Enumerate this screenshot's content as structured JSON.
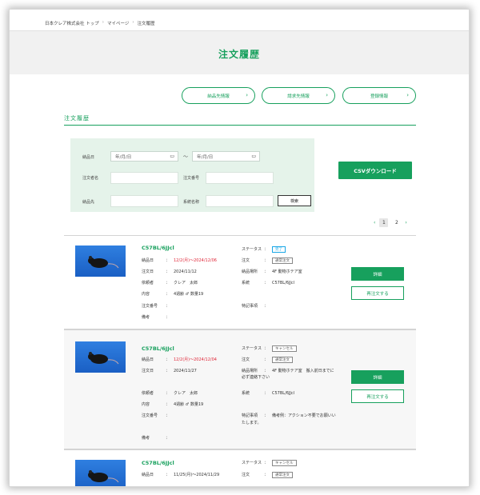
{
  "breadcrumb": [
    "日本クレア株式会社 トップ",
    "マイページ",
    "注文履歴"
  ],
  "page_title": "注文履歴",
  "nav_pills": [
    {
      "label": "納品先情報"
    },
    {
      "label": "請求先情報"
    },
    {
      "label": "登録情報"
    }
  ],
  "section_title": "注文履歴",
  "filter": {
    "delivery_date_label": "納品日",
    "date_from_placeholder": "年/月/日",
    "date_to_placeholder": "年/月/日",
    "range_sep": "〜",
    "order_name_label": "注文者名",
    "order_no_label": "注文番号",
    "destination_label": "納品先",
    "strain_label": "系統名称",
    "search_label": "検索"
  },
  "csv_label": "CSVダウンロード",
  "pagination": {
    "prev": "‹",
    "pages": [
      "1",
      "2"
    ],
    "next": "›",
    "current": "1"
  },
  "orders": [
    {
      "strain": "C57BL/6JJcl",
      "delivery_date": "12/2(月)〜2024/12/06",
      "order_date": "2024/11/12",
      "orderer": "クレア　太郎",
      "content": "4週齢 ♂ 数量19",
      "order_no": "",
      "remarks": "",
      "status_badge": "完了",
      "order_badge": "通常注文",
      "destination": "4F 動物ホテア室",
      "strain_name": "C57BL/6JJcl",
      "special": "",
      "labels": {
        "delivery": "納品日",
        "order_date": "注文日",
        "orderer": "依頼者",
        "content": "内容",
        "order_no": "注文番号",
        "remarks": "備考",
        "status": "ステータス",
        "order": "注文",
        "destination": "納品場所",
        "strain": "系統",
        "special": "特記事項"
      },
      "detail_label": "詳細",
      "reorder_label": "再注文する"
    },
    {
      "strain": "C57BL/6JJcl",
      "delivery_date": "12/2(月)〜2024/12/04",
      "order_date": "2024/11/27",
      "orderer": "クレア　太郎",
      "content": "4週齢 ♂ 数量19",
      "order_no": "",
      "remarks": "",
      "status_badge": "キャンセル",
      "order_badge": "通常注文",
      "destination": "4F 動物ホテア室　搬入前日までに必ず連絡下さい",
      "strain_name": "C57BL/6JJcl",
      "special": "備考例：アクション不要でお願いいたします。",
      "labels": {
        "delivery": "納品日",
        "order_date": "注文日",
        "orderer": "依頼者",
        "content": "内容",
        "order_no": "注文番号",
        "remarks": "備考",
        "status": "ステータス",
        "order": "注文",
        "destination": "納品場所",
        "strain": "系統",
        "special": "特記事項"
      },
      "detail_label": "詳細",
      "reorder_label": "再注文する"
    },
    {
      "strain": "C57BL/6JJcl",
      "delivery_date": "11/25(月)〜2024/11/29",
      "status_badge": "キャンセル",
      "order_badge": "通常注文",
      "labels": {
        "delivery": "納品日",
        "status": "ステータス",
        "order": "注文"
      }
    }
  ],
  "colors": {
    "brand_green": "#17a05d",
    "date_red": "#e0283a",
    "filter_bg": "#e5f3ea",
    "badge_blue": "#1aa7e6"
  }
}
